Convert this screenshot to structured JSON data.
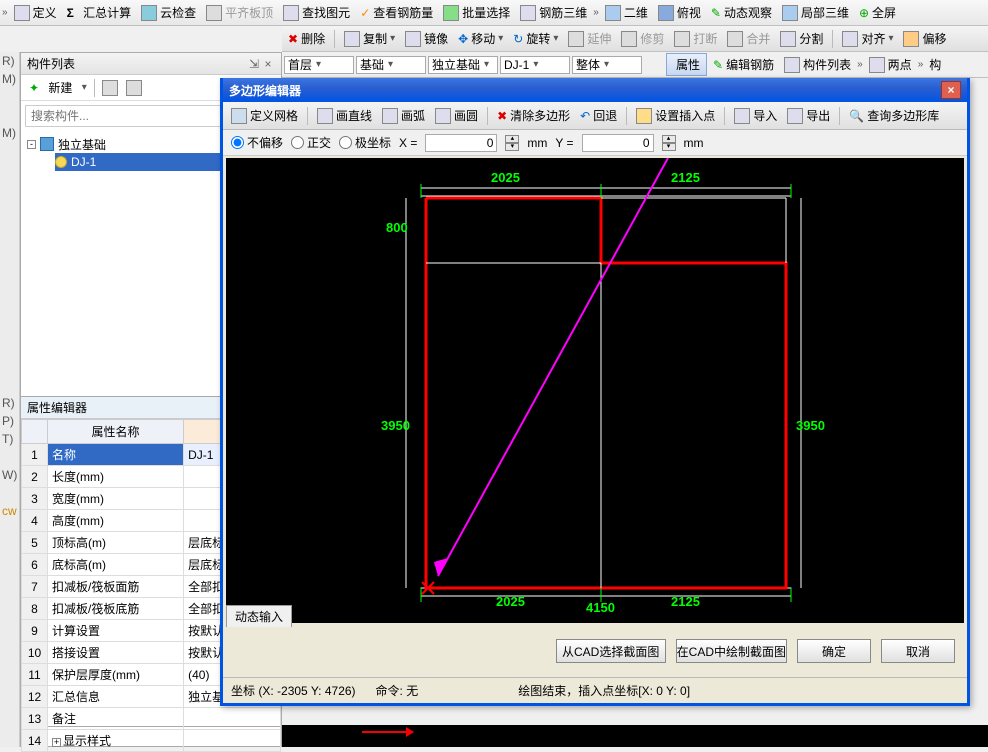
{
  "toolbar1": {
    "define": "定义",
    "sum": "汇总计算",
    "cloud": "云检查",
    "flat": "平齐板顶",
    "find": "查找图元",
    "rebar": "查看钢筋量",
    "batch": "批量选择",
    "rebar3d": "钢筋三维",
    "two_d": "二维",
    "persp": "俯视",
    "dynview": "动态观察",
    "local3d": "局部三维",
    "fullscreen": "全屏"
  },
  "toolbar2": {
    "delete": "删除",
    "copy": "复制",
    "mirror": "镜像",
    "move": "移动",
    "rotate": "旋转",
    "extend": "延伸",
    "trim": "修剪",
    "break": "打断",
    "merge": "合并",
    "split": "分割",
    "align": "对齐",
    "offset": "偏移"
  },
  "toolbar3": {
    "floor": "首层",
    "cat": "基础",
    "subcat": "独立基础",
    "comp": "DJ-1",
    "scope": "整体",
    "prop": "属性",
    "editrebar": "编辑钢筋",
    "complist": "构件列表",
    "twopoint": "两点",
    "other": "构"
  },
  "panel": {
    "title": "构件列表",
    "new": "新建",
    "search_placeholder": "搜索构件...",
    "root": "独立基础",
    "child": "DJ-1"
  },
  "prop": {
    "title": "属性编辑器",
    "col_name": "属性名称",
    "col_val": "属性",
    "rows": [
      {
        "n": "1",
        "name": "名称",
        "val": "DJ-1",
        "sel": true
      },
      {
        "n": "2",
        "name": "长度(mm)",
        "val": ""
      },
      {
        "n": "3",
        "name": "宽度(mm)",
        "val": ""
      },
      {
        "n": "4",
        "name": "高度(mm)",
        "val": ""
      },
      {
        "n": "5",
        "name": "顶标高(m)",
        "val": "层底标高"
      },
      {
        "n": "6",
        "name": "底标高(m)",
        "val": "层底标高"
      },
      {
        "n": "7",
        "name": "扣减板/筏板面筋",
        "val": "全部扣减"
      },
      {
        "n": "8",
        "name": "扣减板/筏板底筋",
        "val": "全部扣减"
      },
      {
        "n": "9",
        "name": "计算设置",
        "val": "按默认计算"
      },
      {
        "n": "10",
        "name": "搭接设置",
        "val": "按默认搭接"
      },
      {
        "n": "11",
        "name": "保护层厚度(mm)",
        "val": "(40)"
      },
      {
        "n": "12",
        "name": "汇总信息",
        "val": "独立基础"
      },
      {
        "n": "13",
        "name": "备注",
        "val": ""
      },
      {
        "n": "14",
        "name": "显示样式",
        "val": "",
        "plus": true
      }
    ]
  },
  "modal": {
    "title": "多边形编辑器",
    "tb": {
      "grid": "定义网格",
      "line": "画直线",
      "arc": "画弧",
      "circle": "画圆",
      "clear": "清除多边形",
      "undo": "回退",
      "insert": "设置插入点",
      "import": "导入",
      "export": "导出",
      "query": "查询多边形库"
    },
    "coord": {
      "no_offset": "不偏移",
      "ortho": "正交",
      "polar": "极坐标",
      "x_lbl": "X =",
      "y_lbl": "Y =",
      "x_val": "0",
      "y_val": "0",
      "unit": "mm"
    },
    "dims": {
      "top1": "2025",
      "top2": "2125",
      "left_top": "800",
      "left": "3950",
      "right": "3950",
      "bot1": "2025",
      "bot2": "2125",
      "bot_total": "4150"
    },
    "buttons": {
      "from_cad": "从CAD选择截面图",
      "draw_cad": "在CAD中绘制截面图",
      "ok": "确定",
      "cancel": "取消"
    },
    "tab": "动态输入",
    "status": {
      "coord_lbl": "坐标",
      "coord_val": "(X: -2305 Y: 4726)",
      "cmd_lbl": "命令:",
      "cmd_val": "无",
      "msg": "绘图结束，插入点坐标[X: 0 Y: 0]"
    }
  },
  "left_letters": [
    "R)",
    "M)",
    "",
    "",
    "M)",
    "",
    "",
    "",
    "",
    "",
    "",
    "",
    "",
    "",
    "",
    "",
    "",
    "",
    "",
    "R)",
    "P)",
    "T)",
    "",
    "W)",
    "",
    "cw"
  ]
}
